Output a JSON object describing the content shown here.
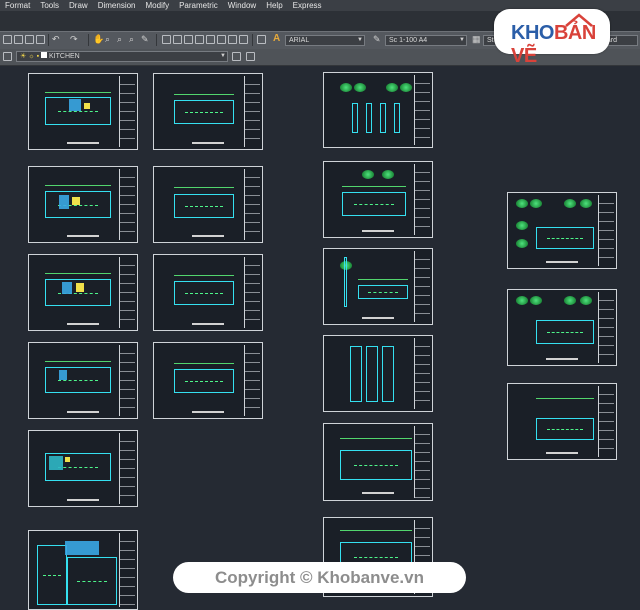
{
  "menubar": {
    "items": [
      "Format",
      "Tools",
      "Draw",
      "Dimension",
      "Modify",
      "Parametric",
      "Window",
      "Help",
      "Express"
    ]
  },
  "toolbar": {
    "font_combo": "ARIAL",
    "scale_combo": "Sc 1-100 A4",
    "style_fragment": "St",
    "std_fragment": "dard"
  },
  "layer_toolbar": {
    "layer_name": "KITCHEN"
  },
  "logo": {
    "part1": "KHO",
    "part2": "BẢN VẼ"
  },
  "watermark": "Copyright © Khobanve.vn",
  "colors": {
    "background": "#252a33",
    "cyan_lines": "#35e0f0",
    "green_lines": "#4df58a",
    "logo_blue": "#2b5ea8",
    "logo_red": "#d9423a"
  }
}
